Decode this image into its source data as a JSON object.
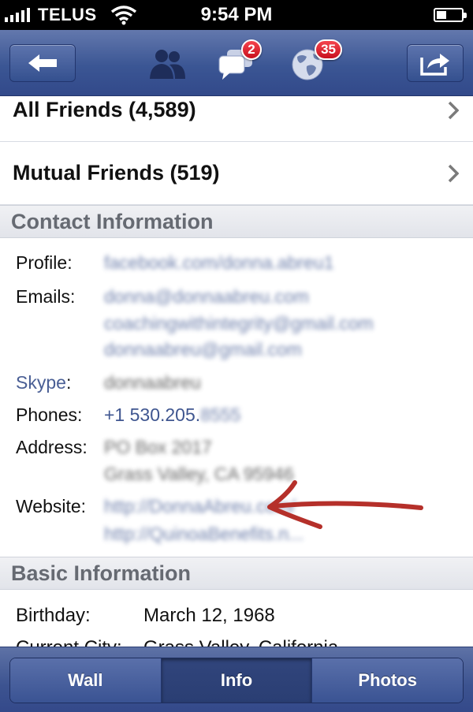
{
  "status_bar": {
    "carrier": "TELUS",
    "time": "9:54 PM"
  },
  "navbar": {
    "back_icon": "left-arrow-icon",
    "friends_icon": "friends-icon",
    "messages_icon": "messages-icon",
    "messages_badge": "2",
    "notifications_icon": "globe-icon",
    "notifications_badge": "35",
    "share_icon": "share-icon"
  },
  "friends": {
    "all_friends": "All Friends (4,589)",
    "mutual_friends": "Mutual Friends (519)"
  },
  "contact": {
    "header": "Contact Information",
    "profile_label": "Profile:",
    "profile_value": "facebook.com/donna.abreu1",
    "emails_label": "Emails:",
    "emails": [
      "donna@donnaabreu.com",
      "coachingwithintegrity@gmail.com",
      "donnaabreu@gmail.com"
    ],
    "skype_label": "Skype",
    "skype_colon": ":",
    "skype_value": "donnaabreu",
    "phones_label": "Phones:",
    "phone_visible": "+1 530.205.",
    "phone_hidden": "8555",
    "address_label": "Address:",
    "address_lines": [
      "PO Box 2017",
      "Grass Valley, CA 95946"
    ],
    "website_label": "Website:",
    "websites": [
      "http://DonnaAbreu.com/",
      "http://QuinoaBenefits.n..."
    ]
  },
  "basic": {
    "header": "Basic Information",
    "birthday_label": "Birthday:",
    "birthday_value": "March 12, 1968",
    "city_label": "Current City:",
    "city_value": "Grass Valley, California"
  },
  "tabs": {
    "wall": "Wall",
    "info": "Info",
    "photos": "Photos",
    "active": "Info"
  },
  "colors": {
    "nav_blue": "#3b5694",
    "link_blue": "#3f5690",
    "badge_red": "#d8141f",
    "annotation_arrow": "#b5302a"
  }
}
